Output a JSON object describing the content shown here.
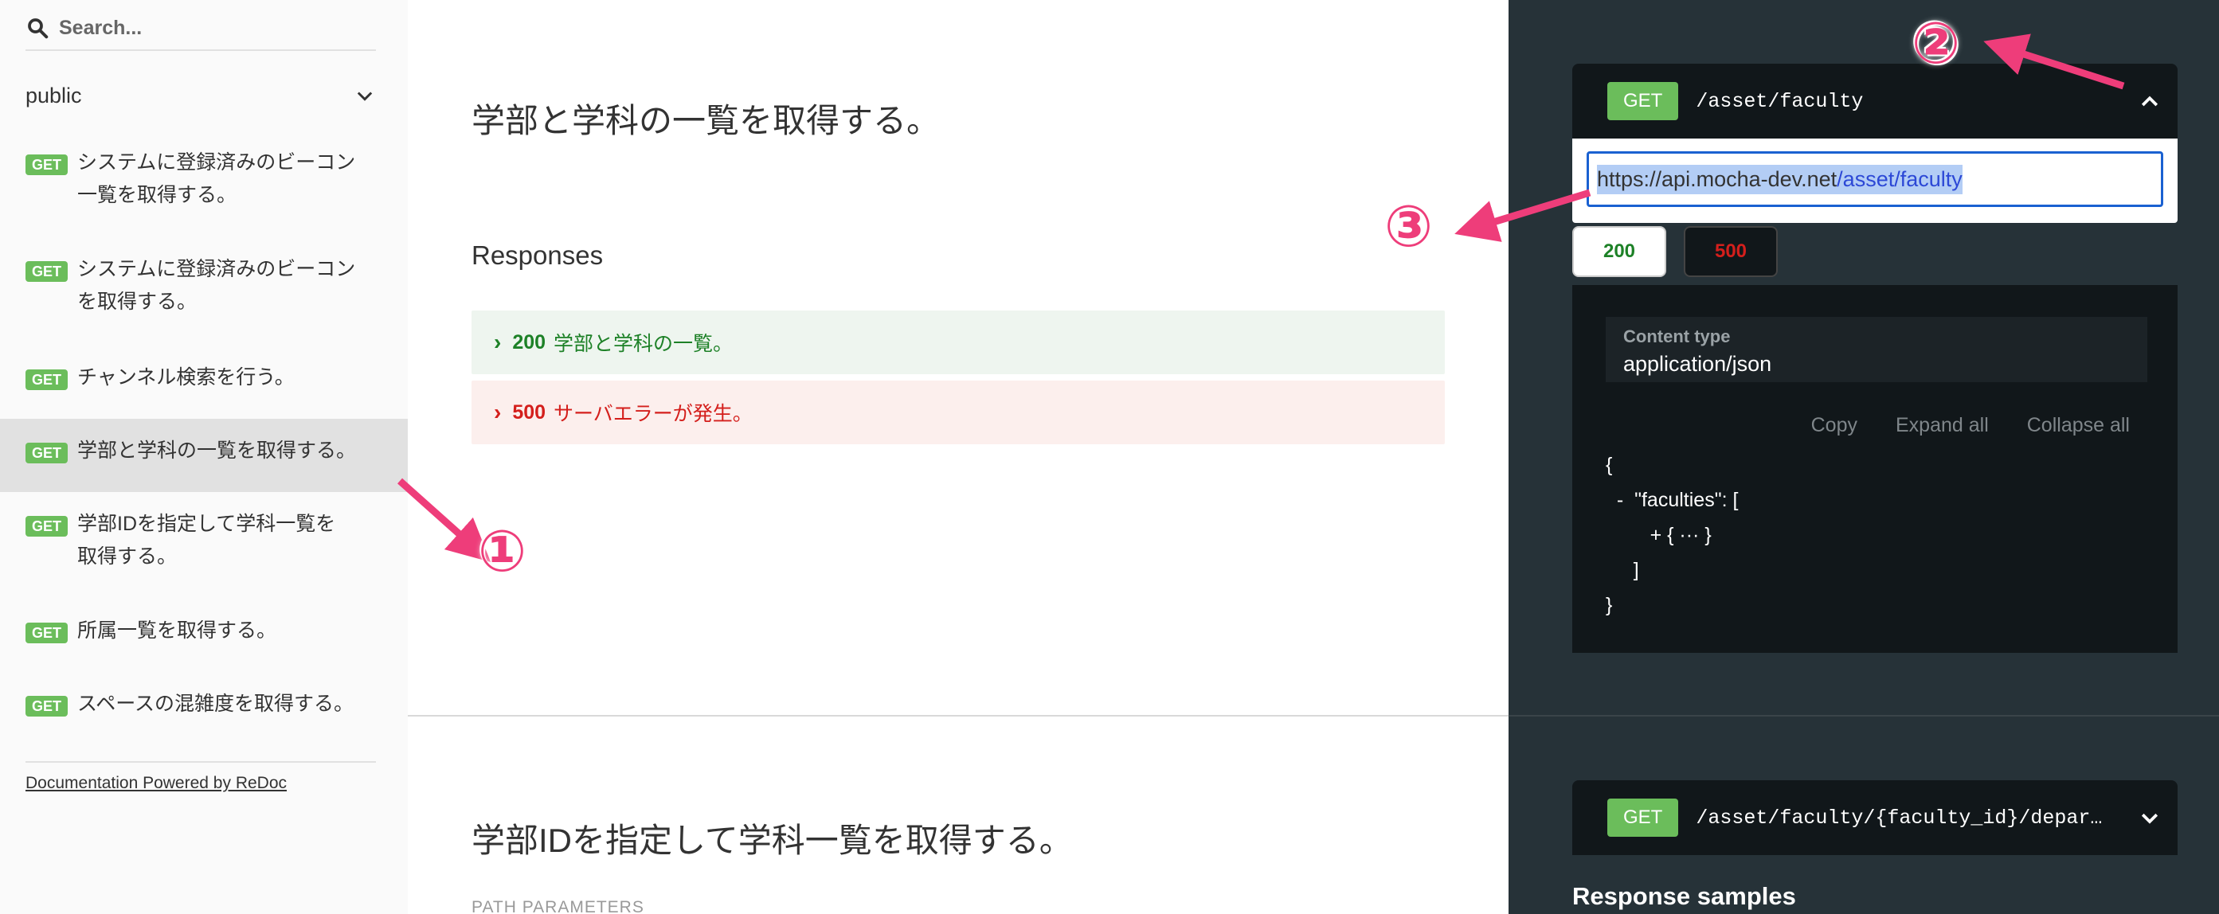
{
  "sidebar": {
    "search_placeholder": "Search...",
    "section_label": "public",
    "items": [
      {
        "method": "GET",
        "label_lines": [
          "システムに登録済みのビーコン",
          "一覧を取得する。"
        ]
      },
      {
        "method": "GET",
        "label_lines": [
          "システムに登録済みのビーコン",
          "を取得する。"
        ]
      },
      {
        "method": "GET",
        "label_lines": [
          "チャンネル検索を行う。"
        ]
      },
      {
        "method": "GET",
        "label_lines": [
          "学部と学科の一覧を取得する。"
        ],
        "active": true
      },
      {
        "method": "GET",
        "label_lines": [
          "学部IDを指定して学科一覧を",
          "取得する。"
        ]
      },
      {
        "method": "GET",
        "label_lines": [
          "所属一覧を取得する。"
        ]
      },
      {
        "method": "GET",
        "label_lines": [
          "スペースの混雑度を取得する。"
        ]
      }
    ],
    "powered_by": "Documentation Powered by ReDoc"
  },
  "main": {
    "operation_title": "学部と学科の一覧を取得する。",
    "responses_title": "Responses",
    "responses": [
      {
        "code": "200",
        "description": "学部と学科の一覧。",
        "status": "success"
      },
      {
        "code": "500",
        "description": "サーバエラーが発生。",
        "status": "error"
      }
    ],
    "next_operation_title": "学部IDを指定して学科一覧を取得する。",
    "path_parameters_label": "PATH PARAMETERS"
  },
  "right_panel": {
    "endpoint": {
      "method": "GET",
      "path": "/asset/faculty"
    },
    "url": {
      "host": "https://api.mocha-dev.net",
      "path": "/asset/faculty"
    },
    "response_tabs": [
      "200",
      "500"
    ],
    "content_type_label": "Content type",
    "content_type_value": "application/json",
    "actions": [
      "Copy",
      "Expand all",
      "Collapse all"
    ],
    "json_lines": [
      "{",
      "  -  \"faculties\": [",
      "        + { ··· }",
      "     ]",
      "}"
    ],
    "next_endpoint": {
      "method": "GET",
      "path": "/asset/faculty/{faculty_id}/depar…"
    },
    "response_samples_label": "Response samples"
  },
  "annotations": {
    "one": "①",
    "two": "②",
    "three": "③",
    "color": "#ee3d7a"
  },
  "colors": {
    "get_badge": "#6bbd5b",
    "success": "#1d8127",
    "error": "#d41f1c",
    "right_bg": "#263238",
    "sidebar_bg": "#fafafa"
  }
}
